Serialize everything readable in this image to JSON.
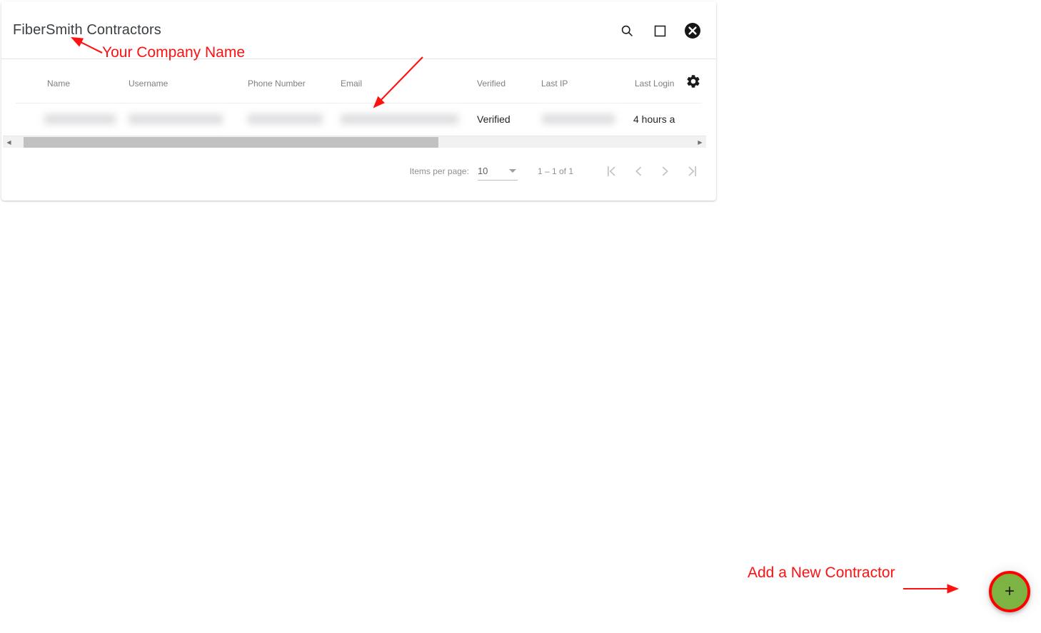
{
  "window": {
    "title": "FiberSmith Contractors",
    "actions": [
      {
        "name": "search-icon",
        "label": "Search"
      },
      {
        "name": "maximize-icon",
        "label": "Maximize"
      },
      {
        "name": "close-icon",
        "label": "Close"
      }
    ]
  },
  "table": {
    "columns": [
      "Name",
      "Username",
      "Phone Number",
      "Email",
      "Verified",
      "Last IP",
      "Last Login"
    ],
    "settings_icon": "gear-icon",
    "rows": [
      {
        "name": "",
        "username": "",
        "phone_number": "",
        "email": "",
        "verified": "Verified",
        "last_ip": "",
        "last_login": "4 hours a"
      }
    ]
  },
  "scrollbar": {
    "left_arrow": "◀",
    "right_arrow": "▶"
  },
  "paginator": {
    "items_per_page_label": "Items per page:",
    "items_per_page_value": "10",
    "range_label": "1 – 1 of 1",
    "buttons": [
      {
        "name": "first-page-button",
        "glyph": "|‹"
      },
      {
        "name": "previous-page-button",
        "glyph": "‹"
      },
      {
        "name": "next-page-button",
        "glyph": "›"
      },
      {
        "name": "last-page-button",
        "glyph": "›|"
      }
    ]
  },
  "fab": {
    "label": "+",
    "fill_color": "#7cb342",
    "ring_color": "#ff0000"
  },
  "annotations": {
    "color": "#ff1111",
    "company_name": "Your Company Name",
    "add_new_contractor": "Add a New Contractor"
  }
}
